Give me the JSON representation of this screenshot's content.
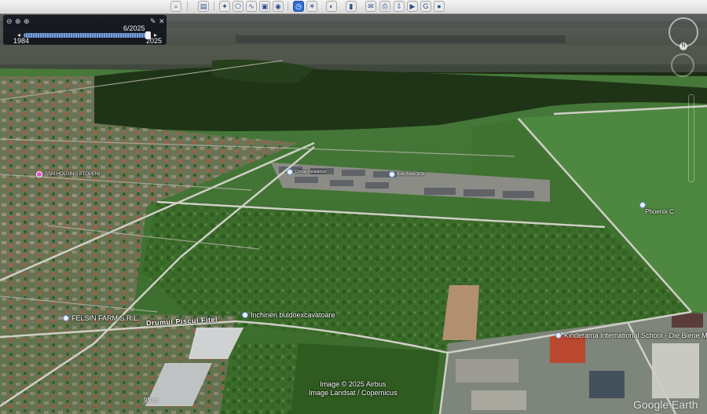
{
  "toolbar": {
    "items": [
      "search-icon",
      "sidebar-icon",
      "placemark-icon",
      "polygon-icon",
      "path-icon",
      "image-overlay-icon",
      "tour-icon",
      "historical-imagery-icon",
      "sunlight-icon",
      "planets-icon",
      "ruler-icon",
      "email-icon",
      "print-icon",
      "save-image-icon",
      "movie-icon",
      "maps-icon",
      "earth-icon"
    ],
    "active": "historical-imagery-icon"
  },
  "time_slider": {
    "current": "6/2025",
    "start": "1984",
    "end": "2025",
    "position": 0.98
  },
  "places": [
    {
      "name": "SSM HOLDING STOPENI",
      "color": "#e34ad4"
    },
    {
      "name": "Phoenix C",
      "color": "#e8f0ff"
    },
    {
      "name": "FELSIN FARM S.R.L.",
      "color": "#e8f0ff"
    },
    {
      "name": "Inchirieri buldoexcavatoare",
      "color": "#e8f0ff"
    },
    {
      "name": "Kinderama International School - Die Biene M",
      "color": "#e8f0ff"
    },
    {
      "name": "Dorian Residence",
      "color": "#e8f0ff"
    },
    {
      "name": "Kids Town SCR",
      "color": "#e8f0ff"
    }
  ],
  "road": "Drumul Piscul Fitel",
  "attribution": {
    "line1": "Image © 2025 Airbus",
    "line2": "Image Landsat / Copernicus"
  },
  "scale": "95 m",
  "logo": "Google Earth",
  "colors": {
    "forest": "#1f3416",
    "field": "#3f6f2a",
    "road": "#cfcfc6",
    "accent": "#2f6fd0"
  }
}
